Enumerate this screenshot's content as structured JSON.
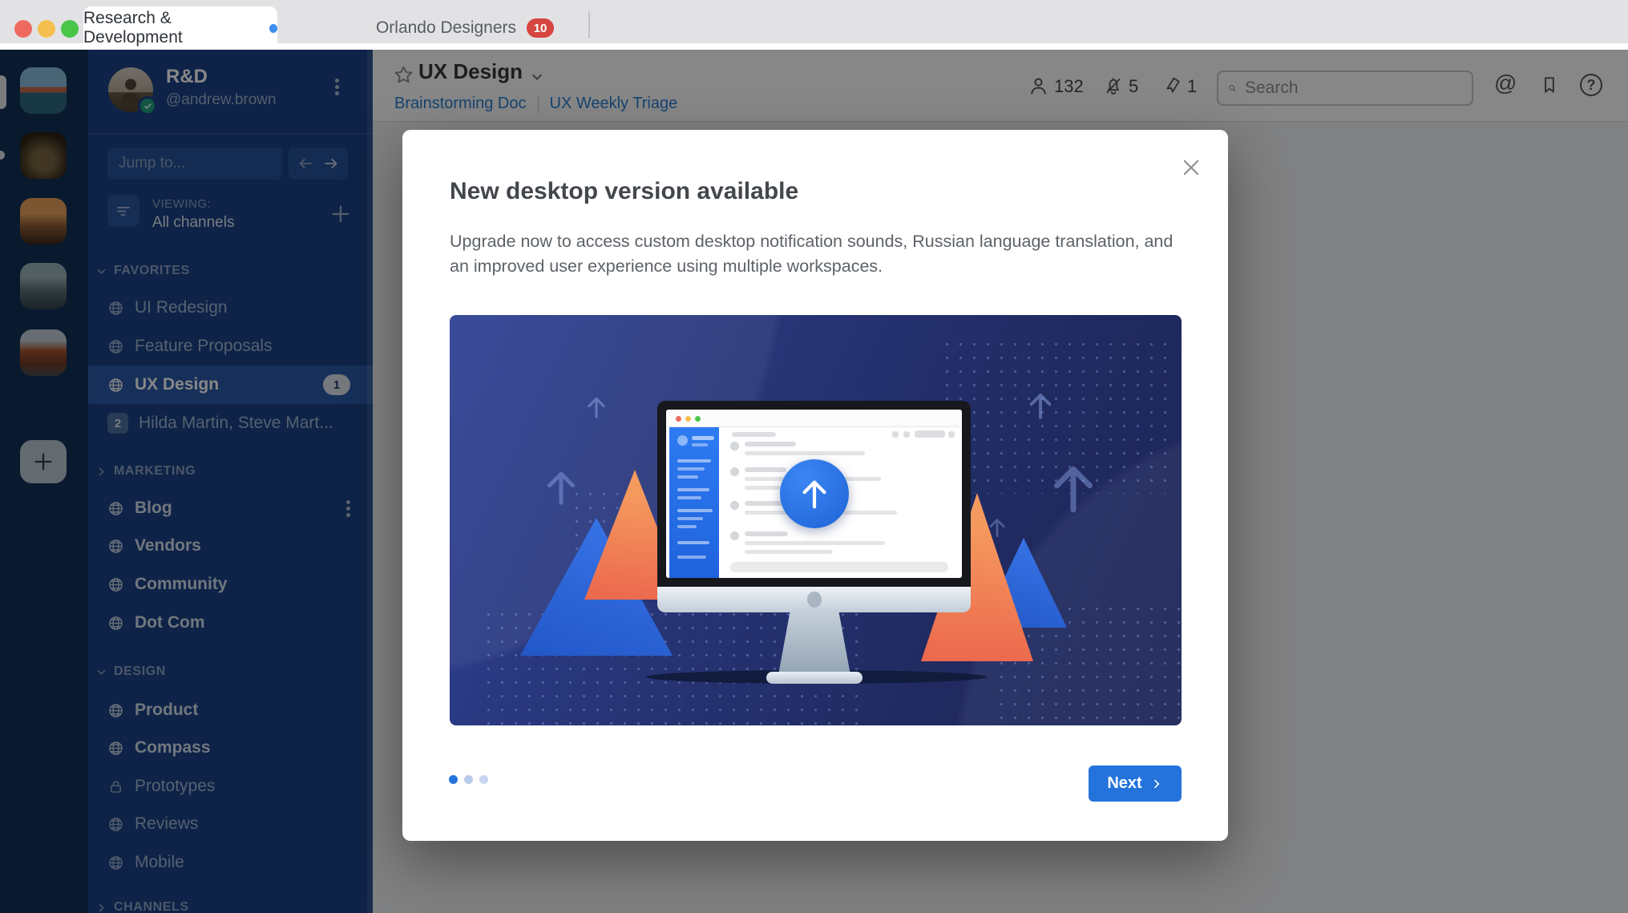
{
  "window": {
    "tabs": [
      {
        "label": "Research & Development",
        "active": true,
        "unread_dot": true
      },
      {
        "label": "Orlando Designers",
        "badge": "10"
      }
    ]
  },
  "rail": {
    "workspaces": [
      "workspace-golden-gate",
      "workspace-cathedral",
      "workspace-city-sunset",
      "workspace-harbor",
      "workspace-street"
    ],
    "has_add_button": true
  },
  "sidebar": {
    "user": {
      "name": "R&D",
      "handle": "@andrew.brown"
    },
    "jump_placeholder": "Jump to...",
    "viewing_label": "VIEWING:",
    "viewing_value": "All channels",
    "sections": [
      {
        "title": "FAVORITES",
        "collapsed": false,
        "items": [
          {
            "label": "UI Redesign",
            "icon": "globe"
          },
          {
            "label": "Feature Proposals",
            "icon": "globe"
          },
          {
            "label": "UX Design",
            "icon": "globe",
            "active": true,
            "badge": "1"
          },
          {
            "label": "Hilda Martin, Steve Mart...",
            "icon": "group-count",
            "badge_left": "2"
          }
        ]
      },
      {
        "title": "MARKETING",
        "collapsed": true,
        "items": [
          {
            "label": "Blog",
            "icon": "globe",
            "bold": true,
            "kebab": true
          },
          {
            "label": "Vendors",
            "icon": "globe",
            "bold": true
          },
          {
            "label": "Community",
            "icon": "globe",
            "bold": true
          },
          {
            "label": "Dot Com",
            "icon": "globe",
            "bold": true
          }
        ]
      },
      {
        "title": "DESIGN",
        "collapsed": false,
        "items": [
          {
            "label": "Product",
            "icon": "globe",
            "bold": true
          },
          {
            "label": "Compass",
            "icon": "globe",
            "bold": true
          },
          {
            "label": "Prototypes",
            "icon": "lock"
          },
          {
            "label": "Reviews",
            "icon": "globe"
          },
          {
            "label": "Mobile",
            "icon": "globe"
          }
        ]
      },
      {
        "title": "CHANNELS",
        "collapsed": true,
        "items": []
      }
    ]
  },
  "header": {
    "title": "UX Design",
    "links": [
      "Brainstorming Doc",
      "UX Weekly Triage"
    ],
    "members_count": "132",
    "muted_count": "5",
    "pinned_count": "1",
    "search_placeholder": "Search"
  },
  "icons": {
    "mention_glyph": "@",
    "help_glyph": "?"
  },
  "modal": {
    "title": "New desktop version available",
    "body": "Upgrade now to access custom desktop notification sounds, Russian language translation, and an improved user experience using multiple workspaces.",
    "next_label": "Next",
    "dots_total": 3,
    "dots_active_index": 0
  },
  "colors": {
    "accent": "#2473dd",
    "link": "#2a7fd4",
    "badge_red": "#d6453f",
    "online_green": "#1fa27e",
    "sidebar": "#1b4286"
  }
}
